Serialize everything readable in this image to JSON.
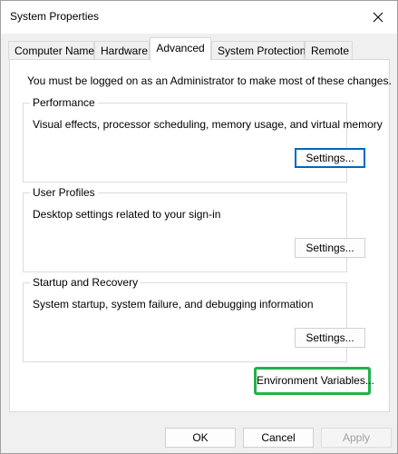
{
  "window": {
    "title": "System Properties"
  },
  "tabs": [
    {
      "label": "Computer Name"
    },
    {
      "label": "Hardware"
    },
    {
      "label": "Advanced",
      "active": true
    },
    {
      "label": "System Protection"
    },
    {
      "label": "Remote"
    }
  ],
  "advanced": {
    "admin_note": "You must be logged on as an Administrator to make most of these changes.",
    "performance": {
      "legend": "Performance",
      "description": "Visual effects, processor scheduling, memory usage, and virtual memory",
      "settings_label": "Settings..."
    },
    "user_profiles": {
      "legend": "User Profiles",
      "description": "Desktop settings related to your sign-in",
      "settings_label": "Settings..."
    },
    "startup_recovery": {
      "legend": "Startup and Recovery",
      "description": "System startup, system failure, and debugging information",
      "settings_label": "Settings..."
    },
    "env_vars_label": "Environment Variables..."
  },
  "footer": {
    "ok_label": "OK",
    "cancel_label": "Cancel",
    "apply_label": "Apply"
  },
  "colors": {
    "highlight": "#21b14b",
    "focus_border": "#0067c0"
  },
  "icons": {
    "close": "close-icon"
  }
}
